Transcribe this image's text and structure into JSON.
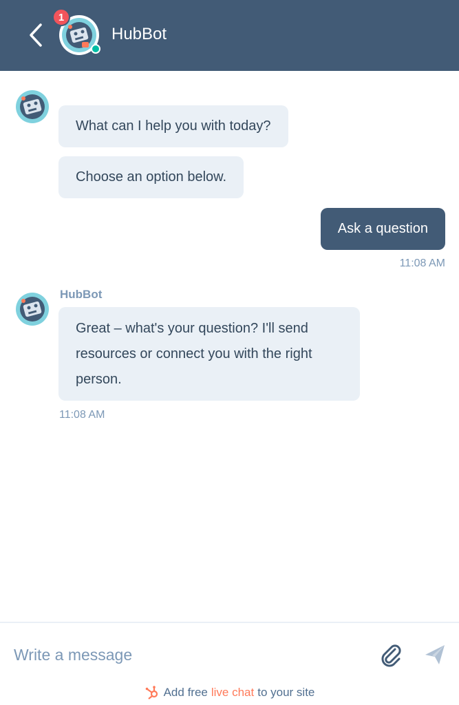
{
  "header": {
    "title": "HubBot",
    "badge_count": "1",
    "back_icon": "chevron-left-icon",
    "status": "online",
    "color": "#425b76"
  },
  "messages": [
    {
      "sender": "bot",
      "text": "What can I help you with today?"
    },
    {
      "sender": "bot",
      "text": "Choose an option below."
    },
    {
      "sender": "user",
      "text": "Ask a question",
      "time": "11:08 AM"
    },
    {
      "sender": "bot",
      "name": "HubBot",
      "text": "Great – what's your question? I'll send resources or connect you with the right person.",
      "time": "11:08 AM"
    }
  ],
  "composer": {
    "placeholder": "Write a message",
    "attach_icon": "paperclip-icon",
    "send_icon": "paper-plane-icon"
  },
  "footer": {
    "prefix": "Add free",
    "link": "live chat",
    "suffix": "to your site",
    "link_color": "#ff7a59"
  }
}
